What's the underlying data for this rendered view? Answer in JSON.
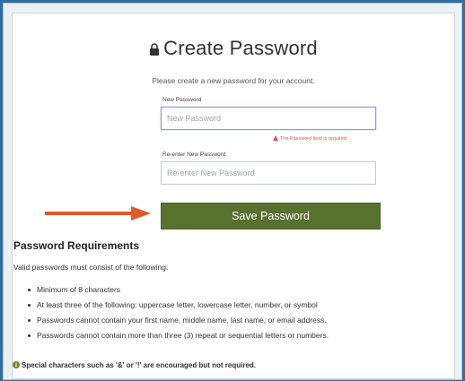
{
  "page": {
    "title": "Create Password",
    "subtitle": "Please create a new password for your account."
  },
  "form": {
    "new_password_label": "New Password",
    "new_password_placeholder": "New Password",
    "error_text": "The Password field is required",
    "reenter_label": "Re-enter New Password",
    "reenter_placeholder": "Re-enter New Password",
    "save_label": "Save Password"
  },
  "requirements": {
    "title": "Password Requirements",
    "intro": "Valid passwords must consist of the following:",
    "items": [
      "Minimum of 8 characters",
      "At least three of the following: uppercase letter, lowercase letter, number, or symbol",
      "Passwords cannot contain your first name, middle name, last name, or email address.",
      "Passwords cannot contain more than three (3) repeat or sequential letters or numbers."
    ],
    "note": "Special characters such as '&' or '!' are encouraged but not required."
  },
  "colors": {
    "save_button": "#58712e",
    "arrow": "#e25a2a",
    "error": "#d9534f",
    "info_icon": "#6b8e23"
  },
  "icons": {
    "title_icon": "lock-icon",
    "error_icon": "warning-icon",
    "note_icon": "info-icon",
    "annotation": "arrow-right-icon"
  }
}
